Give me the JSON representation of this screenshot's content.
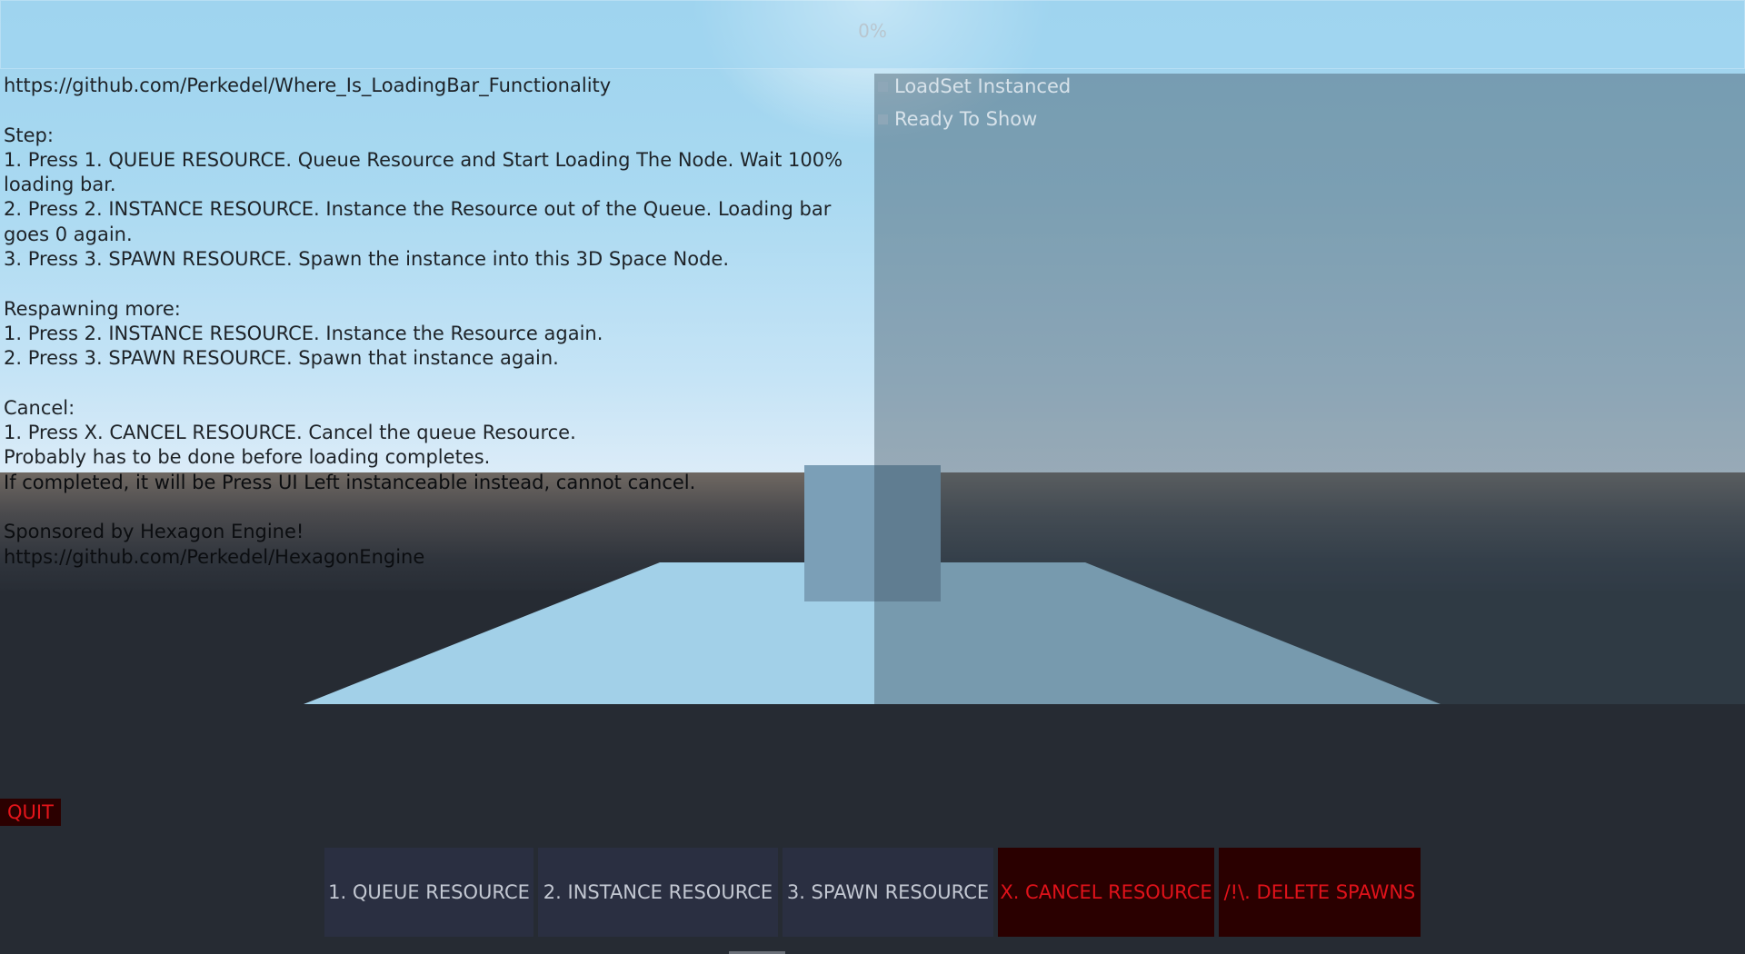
{
  "loading_bar": {
    "progress_text": "0%",
    "progress": 0
  },
  "instructions": {
    "top_lines": "https://github.com/Perkedel/Where_Is_LoadingBar_Functionality\n\nStep:\n1. Press 1. QUEUE RESOURCE. Queue Resource and Start Loading The Node. Wait 100%\nloading bar.\n2. Press 2. INSTANCE RESOURCE. Instance the Resource out of the Queue. Loading bar\ngoes 0 again.\n3. Press 3. SPAWN RESOURCE. Spawn the instance into this 3D Space Node.\n\nRespawning more:\n1. Press 2. INSTANCE RESOURCE. Instance the Resource again.\n2. Press 3. SPAWN RESOURCE. Spawn that instance again.\n\nCancel:\n1. Press X. CANCEL RESOURCE. Cancel the queue Resource.\nProbably has to be done before loading completes.",
    "bottom_lines": "If completed, it will be Press UI Left instanceable instead, cannot cancel.\n\nSponsored by Hexagon Engine!\nhttps://github.com/Perkedel/HexagonEngine"
  },
  "status_checks": [
    {
      "label": "LoadSet Instanced",
      "checked": false
    },
    {
      "label": "Ready To Show",
      "checked": false
    }
  ],
  "quit_label": "QUIT",
  "buttons": [
    {
      "label": "1. QUEUE RESOURCE",
      "style": "normal"
    },
    {
      "label": "2. INSTANCE RESOURCE",
      "style": "normal"
    },
    {
      "label": "3. SPAWN RESOURCE",
      "style": "normal"
    },
    {
      "label": "X. CANCEL RESOURCE",
      "style": "danger"
    },
    {
      "label": "/!\\. DELETE SPAWNS",
      "style": "danger"
    }
  ],
  "colors": {
    "sky": "#a9d9f1",
    "ground": "#262b33",
    "plane": "#a2d0e8",
    "cube": "#7b9fb7",
    "button_bg": "#2a2f41",
    "danger_bg": "#2a0000",
    "danger_text": "#e0121a"
  }
}
